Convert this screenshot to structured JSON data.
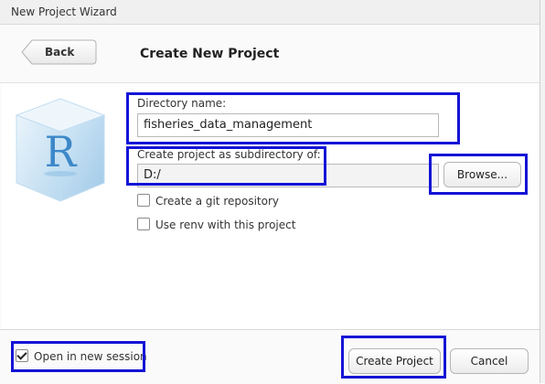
{
  "window": {
    "title": "New Project Wizard"
  },
  "header": {
    "back_label": "Back",
    "title": "Create New Project"
  },
  "form": {
    "directory_name_label": "Directory name:",
    "directory_name_value": "fisheries_data_management",
    "subdirectory_label": "Create project as subdirectory of:",
    "subdirectory_value": "D:/",
    "browse_label": "Browse...",
    "git_label": "Create a git repository",
    "git_checked": false,
    "renv_label": "Use renv with this project",
    "renv_checked": false
  },
  "footer": {
    "open_new_session_label": "Open in new session",
    "open_new_session_checked": true,
    "create_label": "Create Project",
    "cancel_label": "Cancel"
  },
  "colors": {
    "highlight": "#1414d6",
    "logo_blue": "#3d88c9"
  },
  "icons": {
    "logo": "r-logo-cube-icon",
    "back": "back-arrow-icon"
  }
}
